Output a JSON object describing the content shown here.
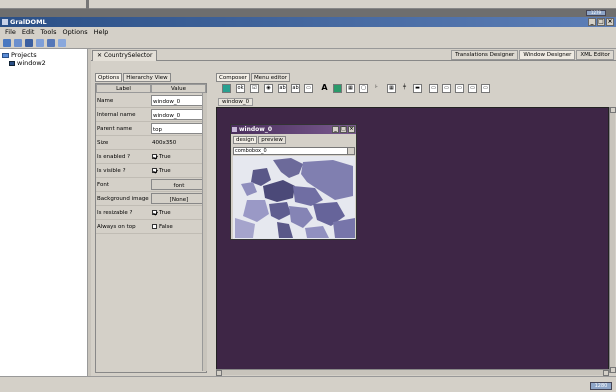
{
  "app": {
    "title": "GralDOML"
  },
  "top_dock": {
    "badge": "1279"
  },
  "menu": [
    "File",
    "Edit",
    "Tools",
    "Options",
    "Help"
  ],
  "toolbar": {
    "icons": [
      "new-icon",
      "open-icon",
      "save-icon",
      "cut-icon",
      "copy-icon",
      "paste-icon"
    ]
  },
  "projects": {
    "root": "Projects",
    "child": "window2"
  },
  "document_tab": {
    "label": "CountrySelector"
  },
  "view_tabs": [
    "Translations Designer",
    "Window Designer",
    "XML Editor"
  ],
  "left_tabs": [
    "Options",
    "Hierarchy View"
  ],
  "prop_header": {
    "label": "Label",
    "value": "Value"
  },
  "properties": [
    {
      "label": "Name",
      "value": "window_0",
      "kind": "field"
    },
    {
      "label": "Internal name",
      "value": "window_0",
      "kind": "field"
    },
    {
      "label": "Parent name",
      "value": "top",
      "kind": "field"
    },
    {
      "label": "Size",
      "value": "400x350",
      "kind": "text"
    },
    {
      "label": "Is enabled ?",
      "value": "True",
      "kind": "check",
      "checked": true
    },
    {
      "label": "Is visible ?",
      "value": "True",
      "kind": "check",
      "checked": true
    },
    {
      "label": "Font",
      "value": "font",
      "kind": "button"
    },
    {
      "label": "Background image",
      "value": "[None]",
      "kind": "button"
    },
    {
      "label": "Is resizable ?",
      "value": "True",
      "kind": "check",
      "checked": true
    },
    {
      "label": "Always on top",
      "value": "False",
      "kind": "check",
      "checked": false
    }
  ],
  "composer_tabs": [
    "Composer",
    "Menu editor"
  ],
  "composer_window_label": "window_0",
  "mini_window": {
    "title": "window_0",
    "tabs": [
      "design",
      "preview"
    ],
    "combo_text": "combobox_0"
  },
  "status_badge": "1280"
}
